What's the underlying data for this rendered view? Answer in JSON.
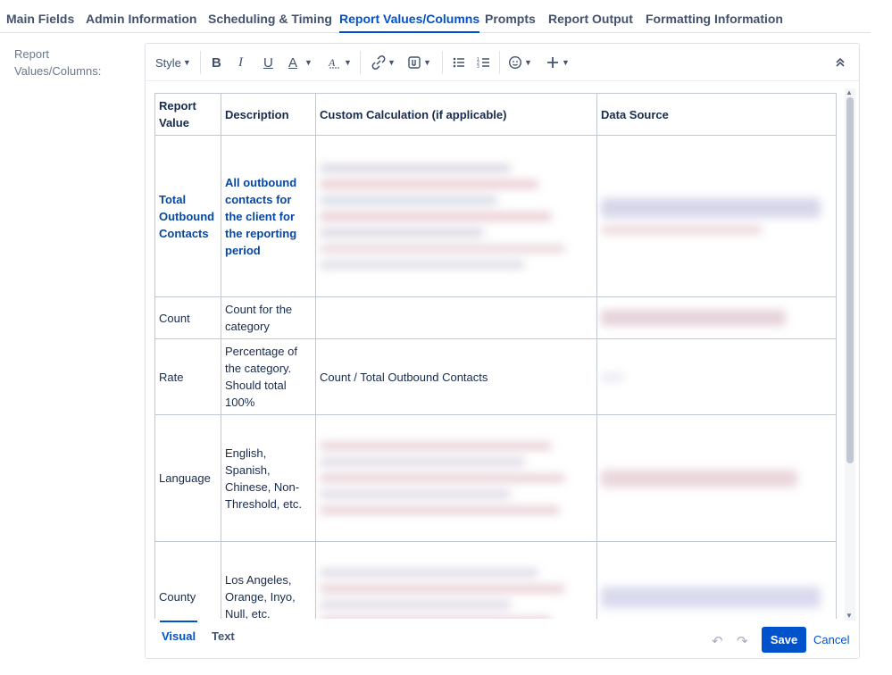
{
  "tabs": [
    {
      "label": "Main Fields",
      "active": false
    },
    {
      "label": "Admin Information",
      "active": false
    },
    {
      "label": "Scheduling & Timing",
      "active": false
    },
    {
      "label": "Report Values/Columns",
      "active": true
    },
    {
      "label": "Prompts",
      "active": false
    },
    {
      "label": "Report Output",
      "active": false
    },
    {
      "label": "Formatting Information",
      "active": false
    }
  ],
  "field": {
    "label": "Report Values/Columns:"
  },
  "toolbar": {
    "style_label": "Style",
    "icons": [
      "chevron-down-icon",
      "bold-icon",
      "italic-icon",
      "underline-icon",
      "text-color-icon",
      "clear-formatting-icon",
      "link-icon",
      "attachment-icon",
      "bullet-list-icon",
      "numbered-list-icon",
      "emoji-icon",
      "plus-icon",
      "collapse-icon"
    ],
    "bold": "B",
    "italic": "I",
    "underline": "U",
    "text_color": "A"
  },
  "table": {
    "headers": [
      "Report Value",
      "Description",
      "Custom Calculation (if applicable)",
      "Data Source"
    ],
    "rows": [
      {
        "value": "Total Outbound Contacts",
        "description": "All outbound contacts for the client for the reporting period",
        "calc": "",
        "calc_blurred": true,
        "emphasis": true
      },
      {
        "value": "Count",
        "description": "Count for the category",
        "calc": "",
        "calc_blurred": false
      },
      {
        "value": "Rate",
        "description": "Percentage of the category. Should total 100%",
        "calc": "Count / Total Outbound Contacts",
        "calc_blurred": false
      },
      {
        "value": "Language",
        "description": "English, Spanish, Chinese, Non-Threshold, etc.",
        "calc": "",
        "calc_blurred": true
      },
      {
        "value": "County",
        "description": "Los Angeles, Orange, Inyo, Null, etc.",
        "calc": "",
        "calc_blurred": true
      }
    ]
  },
  "footer": {
    "visual_label": "Visual",
    "text_label": "Text",
    "save_label": "Save",
    "cancel_label": "Cancel"
  },
  "colors": {
    "accent": "#0052cc",
    "emphasis_text": "#0747a6",
    "border": "#c1c7d0"
  }
}
